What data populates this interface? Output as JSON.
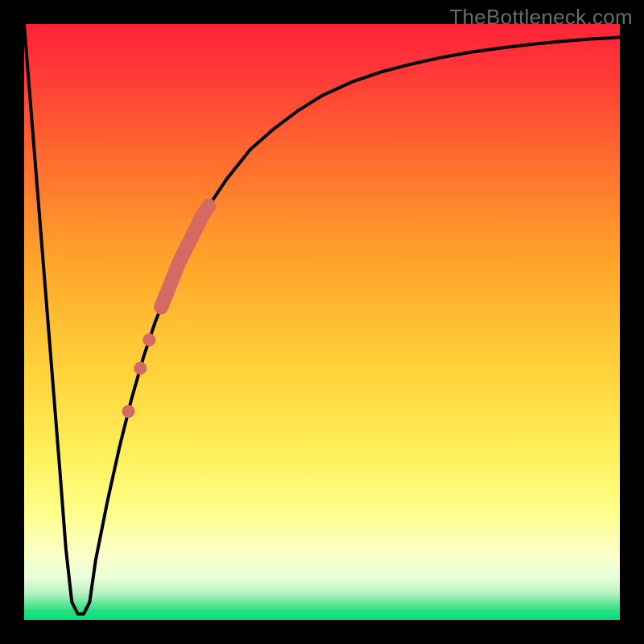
{
  "watermark": "TheBottleneck.com",
  "colors": {
    "frame": "#000000",
    "curve": "#000000",
    "markers": "#d46a62",
    "gradient_top": "#ff2a3a",
    "gradient_mid_upper": "#ff8a2a",
    "gradient_mid": "#ffd83a",
    "gradient_mid_lower": "#ffff8a",
    "gradient_lower": "#f8ffd0",
    "gradient_green_top": "#b8f5c0",
    "gradient_green": "#2de07a",
    "gradient_green_bottom": "#00e07f"
  },
  "chart_data": {
    "type": "line",
    "title": "",
    "xlabel": "",
    "ylabel": "",
    "xlim": [
      0,
      100
    ],
    "ylim": [
      0,
      100
    ],
    "grid": false,
    "legend": false,
    "series": [
      {
        "name": "bottleneck-curve",
        "x": [
          0,
          2,
          4,
          6,
          7,
          8,
          9,
          10,
          11,
          12,
          14,
          16,
          18,
          20,
          22,
          24,
          26,
          28,
          30,
          34,
          38,
          42,
          46,
          50,
          55,
          60,
          65,
          70,
          75,
          80,
          85,
          90,
          95,
          100
        ],
        "y": [
          100,
          75,
          50,
          25,
          12,
          3,
          1,
          1,
          3,
          10,
          20,
          29,
          37,
          44,
          50,
          55,
          60,
          64,
          68,
          74,
          79,
          82.5,
          85.5,
          88,
          90.3,
          92,
          93.3,
          94.4,
          95.3,
          96,
          96.6,
          97.1,
          97.5,
          97.8
        ]
      }
    ],
    "markers": {
      "name": "highlight-segment",
      "type": "scatter",
      "color": "#d46a62",
      "points_on_curve_x": [
        17.5,
        19.5,
        21,
        23,
        25,
        27,
        29,
        31
      ],
      "segment_x_range": [
        23,
        31
      ],
      "dots_x": [
        17.5,
        19.5,
        21
      ]
    },
    "ideal_band_y": [
      0,
      3
    ]
  }
}
